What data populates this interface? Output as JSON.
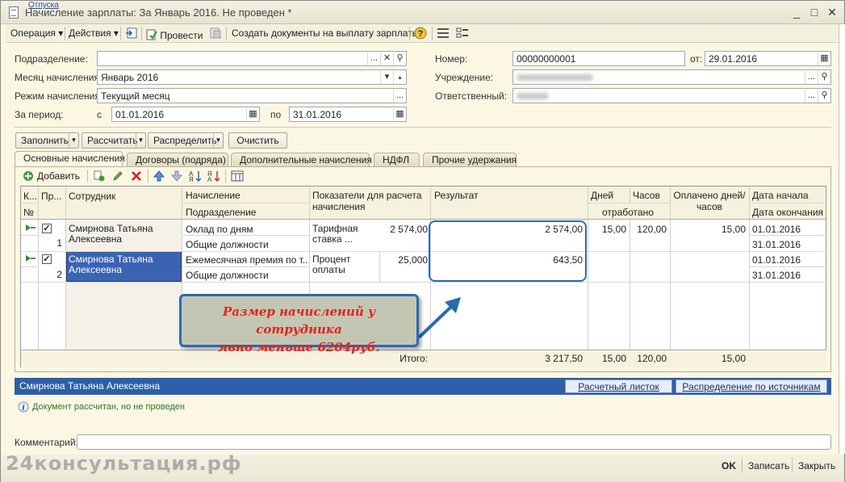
{
  "window": {
    "title": "Начисление зарплаты: За Январь 2016. Не проведен *",
    "bg_tab_text": "Отпуска"
  },
  "toolbar": {
    "operation": "Операция",
    "actions": "Действия",
    "post": "Провести",
    "create_payment_docs": "Создать документы на выплату зарплаты"
  },
  "form": {
    "subdivision_label": "Подразделение:",
    "subdivision_value": "",
    "month_label": "Месяц начисления:",
    "month_value": "Январь 2016",
    "mode_label": "Режим начисления:",
    "mode_value": "Текущий месяц",
    "period_label": "За период:",
    "period_from_label": "с",
    "period_from": "01.01.2016",
    "period_to_label": "по",
    "period_to": "31.01.2016",
    "number_label": "Номер:",
    "number_value": "00000000001",
    "date_label": "от:",
    "date_value": "29.01.2016",
    "institution_label": "Учреждение:",
    "responsible_label": "Ответственный:"
  },
  "buttons": {
    "fill": "Заполнить",
    "calculate": "Рассчитать",
    "distribute": "Распределить",
    "clear": "Очистить"
  },
  "tabs": [
    {
      "label": "Основные начисления",
      "active": true
    },
    {
      "label": "Договоры (подряда)",
      "active": false
    },
    {
      "label": "Дополнительные начисления",
      "active": false
    },
    {
      "label": "НДФЛ",
      "active": false
    },
    {
      "label": "Прочие удержания",
      "active": false
    }
  ],
  "grid_toolbar": {
    "add": "Добавить"
  },
  "table": {
    "headers": {
      "k": "К...",
      "pr": "Пр...",
      "no": "№",
      "employee": "Сотрудник",
      "accrual": "Начисление",
      "division": "Подразделение",
      "indicators": "Показатели для расчета начисления",
      "result": "Результат",
      "days": "Дней",
      "hours": "Часов",
      "worked": "отработано",
      "paid": "Оплачено дней/часов",
      "date_start": "Дата начала",
      "date_end": "Дата окончания"
    },
    "rows": [
      {
        "number": "1",
        "employee": "Смирнова Татьяна Алексеевна",
        "accrual": "Оклад по дням",
        "division": "Общие должности",
        "indicator_name": "Тарифная ставка ...",
        "indicator_value": "2 574,00",
        "result": "2 574,00",
        "days": "15,00",
        "hours": "120,00",
        "paid": "15,00",
        "date_start": "01.01.2016",
        "date_end": "31.01.2016"
      },
      {
        "number": "2",
        "employee": "Смирнова Татьяна Алексеевна",
        "accrual": "Ежемесячная премия по т...",
        "division": "Общие должности",
        "indicator_name": "Процент оплаты",
        "indicator_value": "25,000",
        "result": "643,50",
        "days": "",
        "hours": "",
        "paid": "",
        "date_start": "01.01.2016",
        "date_end": "31.01.2016"
      }
    ],
    "totals": {
      "label": "Итого:",
      "result": "3 217,50",
      "days": "15,00",
      "hours": "120,00",
      "paid": "15,00"
    }
  },
  "annotation": {
    "line1": "Размер начислений у сотрудника",
    "line2": "явно меньше 6204руб."
  },
  "bottom": {
    "employee_name": "Смирнова Татьяна Алексеевна",
    "payslip_button": "Расчетный листок",
    "sources_button": "Распределение по источникам",
    "status_text": "Документ рассчитан, но не проведен",
    "comment_label": "Комментарий:",
    "comment_value": "",
    "watermark": "24консультация.рф",
    "ok": "OK",
    "save": "Записать",
    "close": "Закрыть"
  },
  "colors": {
    "window_bg": "#fbf7e3",
    "selection_blue": "#2d5fa8",
    "callout_border": "#2a6bb0",
    "callout_text": "#e2231a",
    "status_text": "#2a7a2a"
  }
}
